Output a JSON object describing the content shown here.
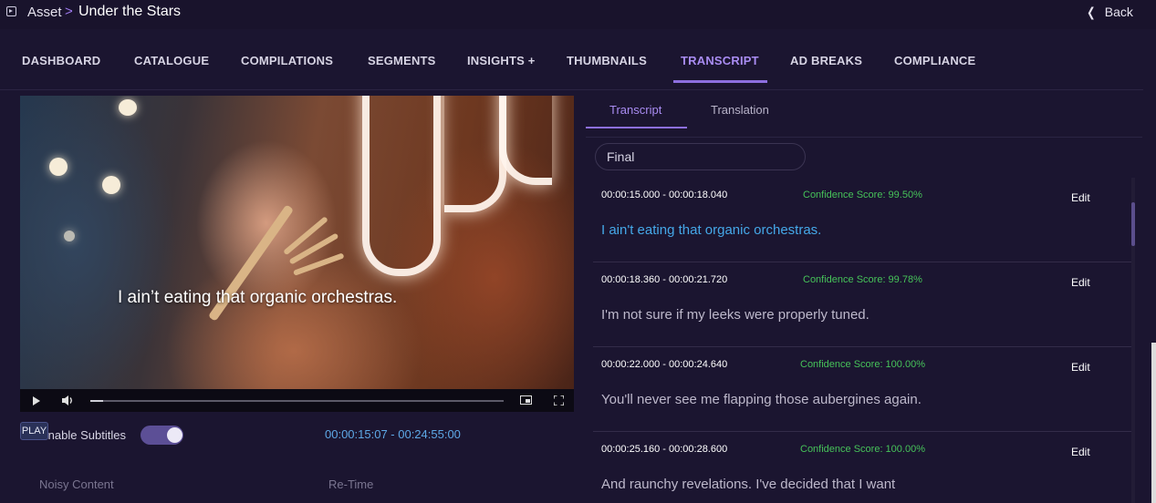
{
  "breadcrumb": {
    "root": "Asset",
    "separator": ">",
    "title": "Under the Stars"
  },
  "back_label": "Back",
  "nav": [
    {
      "label": "DASHBOARD",
      "active": false
    },
    {
      "label": "CATALOGUE",
      "active": false
    },
    {
      "label": "COMPILATIONS",
      "active": false
    },
    {
      "label": "SEGMENTS",
      "active": false
    },
    {
      "label": "INSIGHTS +",
      "active": false
    },
    {
      "label": "THUMBNAILS",
      "active": false
    },
    {
      "label": "TRANSCRIPT",
      "active": true
    },
    {
      "label": "AD BREAKS",
      "active": false
    },
    {
      "label": "COMPLIANCE",
      "active": false
    }
  ],
  "player": {
    "subtitle": "I ain’t eating that organic orchestras.",
    "progress_fraction": 0.03,
    "play_badge": "PLAY",
    "enable_subtitles_label": "Enable Subtitles",
    "subtitles_enabled": true,
    "timecode": "00:00:15:07 - 00:24:55:00",
    "noisy_content_label": "Noisy Content",
    "retime_label": "Re-Time"
  },
  "panel_tabs": [
    {
      "label": "Transcript",
      "active": true
    },
    {
      "label": "Translation",
      "active": false
    }
  ],
  "filter": {
    "value": "Final"
  },
  "entries": [
    {
      "time": "00:00:15.000 - 00:00:18.040",
      "confidence": "Confidence Score: 99.50%",
      "edit": "Edit",
      "text": "I ain't eating that organic orchestras.",
      "active": true
    },
    {
      "time": "00:00:18.360 - 00:00:21.720",
      "confidence": "Confidence Score: 99.78%",
      "edit": "Edit",
      "text": "I'm not sure if my leeks were properly tuned.",
      "active": false
    },
    {
      "time": "00:00:22.000 - 00:00:24.640",
      "confidence": "Confidence Score: 100.00%",
      "edit": "Edit",
      "text": "You'll never see me flapping those aubergines again.",
      "active": false
    },
    {
      "time": "00:00:25.160 - 00:00:28.600",
      "confidence": "Confidence Score: 100.00%",
      "edit": "Edit",
      "text": "And raunchy revelations. I've decided that I want",
      "active": false
    }
  ],
  "colors": {
    "accent": "#8d6fe0",
    "confidence": "#46c259",
    "active_text": "#45a8e8",
    "background": "#1b1530"
  }
}
